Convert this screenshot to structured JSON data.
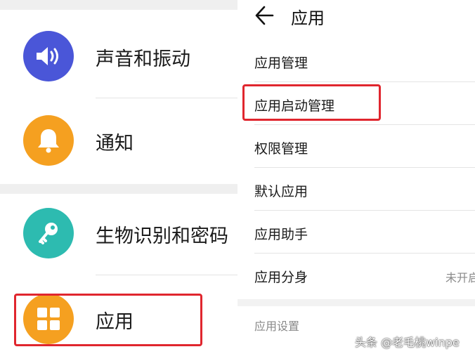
{
  "settings_list": {
    "items": [
      {
        "label": "声音和振动",
        "icon": "speaker-icon",
        "color": "#4a56d8"
      },
      {
        "label": "通知",
        "icon": "bell-icon",
        "color": "#f5a020"
      },
      {
        "label": "生物识别和密码",
        "icon": "key-icon",
        "color": "#2dbbb0"
      },
      {
        "label": "应用",
        "icon": "apps-grid-icon",
        "color": "#f5a020"
      }
    ]
  },
  "apps_page": {
    "title": "应用",
    "back_icon": "arrow-left-icon",
    "items": [
      {
        "label": "应用管理"
      },
      {
        "label": "应用启动管理"
      },
      {
        "label": "权限管理"
      },
      {
        "label": "默认应用"
      },
      {
        "label": "应用助手"
      },
      {
        "label": "应用分身",
        "value": "未开启"
      }
    ],
    "section_title": "应用设置"
  },
  "highlight_color": "#e0262e",
  "watermark": "头条 @老毛桃winpe"
}
